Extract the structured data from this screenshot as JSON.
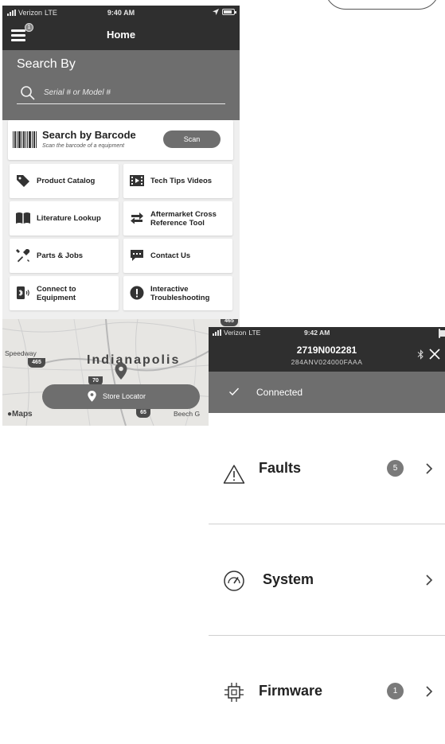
{
  "screen1": {
    "status": {
      "carrier": "Verizon",
      "network": "LTE",
      "time": "9:40 AM"
    },
    "nav": {
      "title": "Home",
      "menu_badge": "1"
    },
    "search": {
      "label": "Search By",
      "placeholder": "Serial # or Model #"
    },
    "barcode": {
      "title": "Search by Barcode",
      "subtitle": "Scan the barcode of a equipment",
      "button": "Scan"
    },
    "tiles": [
      {
        "label": "Product Catalog",
        "icon": "tag-icon"
      },
      {
        "label": "Tech Tips Videos",
        "icon": "film-icon"
      },
      {
        "label": "Literature Lookup",
        "icon": "book-icon"
      },
      {
        "label": "Aftermarket Cross Reference Tool",
        "icon": "swap-arrows-icon"
      },
      {
        "label": "Parts & Jobs",
        "icon": "tools-icon"
      },
      {
        "label": "Contact Us",
        "icon": "chat-icon"
      },
      {
        "label": "Connect to Equipment",
        "icon": "bluetooth-phone-icon"
      },
      {
        "label": "Interactive Troubleshooting",
        "icon": "alert-circle-icon"
      }
    ],
    "map": {
      "city": "Indianapolis",
      "speedway": "Speedway",
      "beech": "Beech G",
      "maps_label": "Maps",
      "shields": [
        "465",
        "465",
        "70",
        "65"
      ],
      "store_button": "Store Locator"
    }
  },
  "screen2": {
    "status": {
      "carrier": "Verizon",
      "network": "LTE",
      "time": "9:42 AM"
    },
    "header": {
      "serial": "2719N002281",
      "model": "284ANV024000FAAA"
    },
    "connected": "Connected",
    "rows": [
      {
        "label": "Faults",
        "count": "5"
      },
      {
        "label": "System",
        "count": ""
      },
      {
        "label": "Firmware",
        "count": "1"
      }
    ]
  }
}
